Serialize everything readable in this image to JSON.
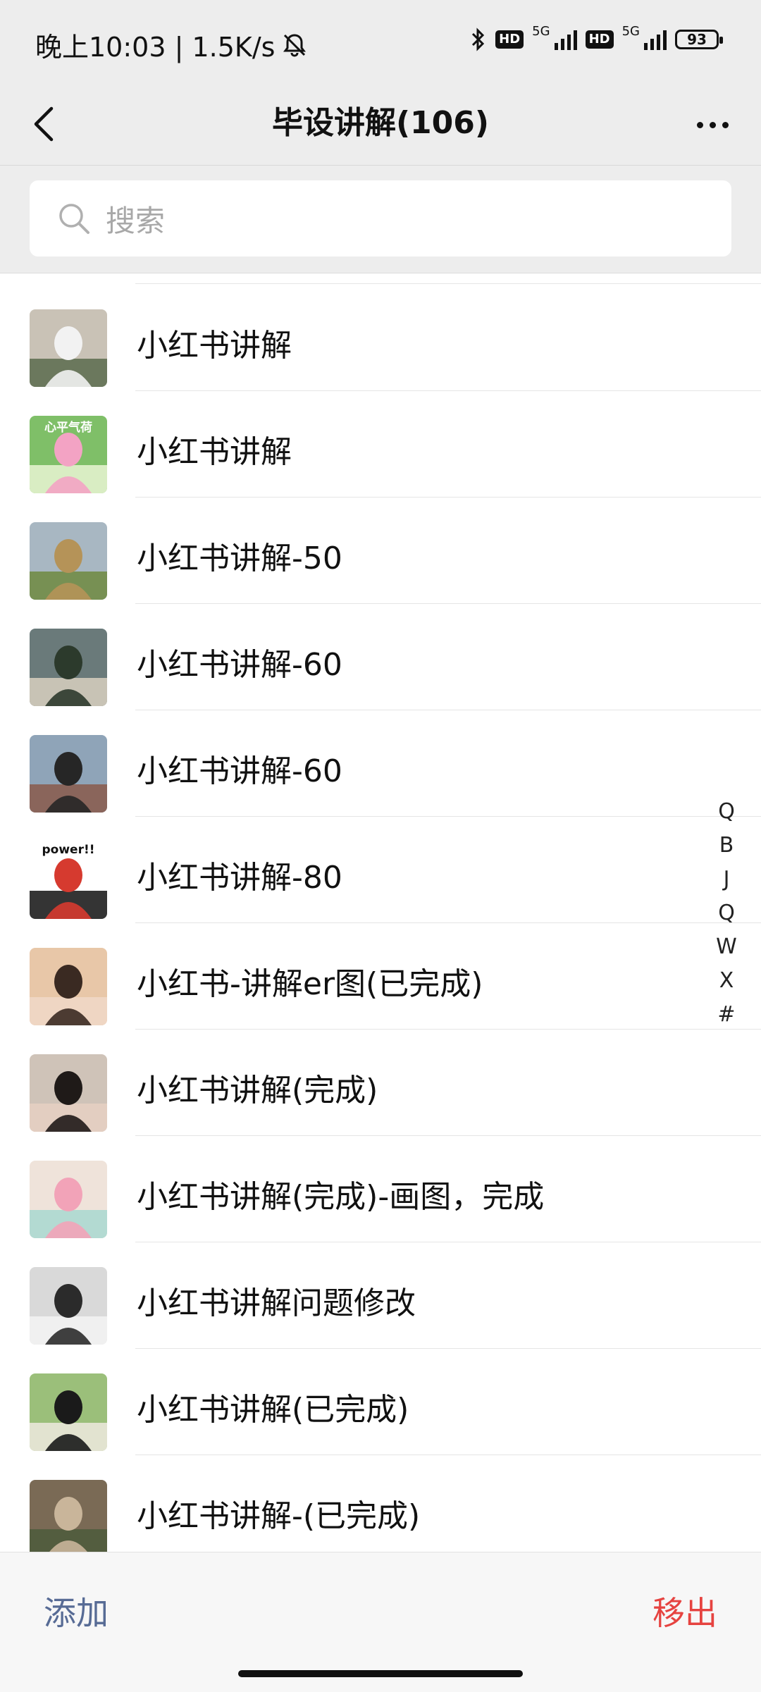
{
  "status_bar": {
    "time_text": "晚上10:03 | 1.5K/s",
    "network_label_1": "5G",
    "network_label_2": "5G",
    "hd_label": "HD",
    "battery": "93"
  },
  "header": {
    "title": "毕设讲解(106)"
  },
  "search": {
    "placeholder": "搜索"
  },
  "members": [
    {
      "name": "小红书讲解",
      "avatar": {
        "bg": "#c9c2b6",
        "fg": "#f2f2f2",
        "accent": "#5a6b4e",
        "text": ""
      }
    },
    {
      "name": "小红书讲解",
      "avatar": {
        "bg": "#7fbf68",
        "fg": "#f3a3c4",
        "accent": "#e9f4d4",
        "text": "心平气荷"
      }
    },
    {
      "name": "小红书讲解-50",
      "avatar": {
        "bg": "#a8b7c2",
        "fg": "#b59358",
        "accent": "#6f8a3f",
        "text": ""
      }
    },
    {
      "name": "小红书讲解-60",
      "avatar": {
        "bg": "#6a7a7a",
        "fg": "#2c3a2c",
        "accent": "#d8d0c0",
        "text": ""
      }
    },
    {
      "name": "小红书讲解-60",
      "avatar": {
        "bg": "#8fa4b8",
        "fg": "#262626",
        "accent": "#8a5a4a",
        "text": ""
      }
    },
    {
      "name": "小红书讲解-80",
      "avatar": {
        "bg": "#ffffff",
        "fg": "#d63a2f",
        "accent": "#111111",
        "text": "power!!"
      }
    },
    {
      "name": "小红书-讲解er图(已完成)",
      "avatar": {
        "bg": "#e8c7a8",
        "fg": "#3a2a22",
        "accent": "#f0d8c8",
        "text": ""
      }
    },
    {
      "name": "小红书讲解(完成)",
      "avatar": {
        "bg": "#cfc3b8",
        "fg": "#1f1a18",
        "accent": "#e6d0c2",
        "text": ""
      }
    },
    {
      "name": "小红书讲解(完成)-画图，完成",
      "avatar": {
        "bg": "#efe3da",
        "fg": "#f2a3b8",
        "accent": "#a8d8d0",
        "text": ""
      }
    },
    {
      "name": "小红书讲解问题修改",
      "avatar": {
        "bg": "#d9d9d9",
        "fg": "#2b2b2b",
        "accent": "#f3f3f3",
        "text": ""
      }
    },
    {
      "name": "小红书讲解(已完成)",
      "avatar": {
        "bg": "#9bbf7a",
        "fg": "#1a1a1a",
        "accent": "#efe9df",
        "text": ""
      }
    },
    {
      "name": "小红书讲解-(已完成)",
      "avatar": {
        "bg": "#7a6a55",
        "fg": "#c9b59a",
        "accent": "#4c5a3c",
        "text": ""
      }
    }
  ],
  "index_bar": [
    "Q",
    "B",
    "J",
    "Q",
    "W",
    "X",
    "#"
  ],
  "bottom_bar": {
    "add_label": "添加",
    "remove_label": "移出"
  },
  "colors": {
    "header_bg": "#ededed",
    "link_blue": "#576b95",
    "danger_red": "#e64340"
  }
}
